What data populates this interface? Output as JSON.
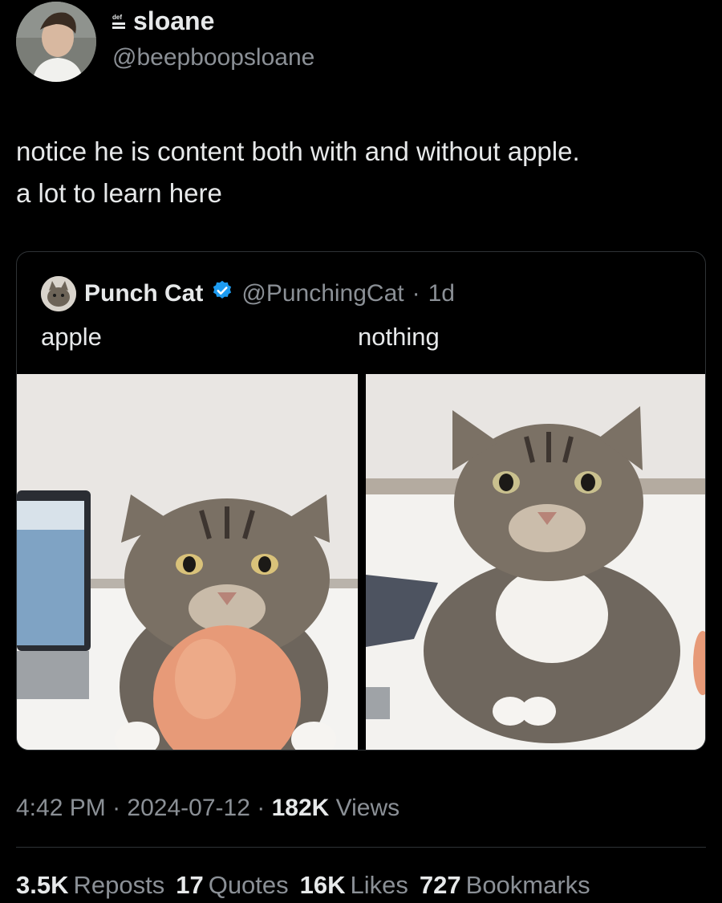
{
  "post": {
    "author_name": "sloane",
    "author_handle": "@beepboopsloane",
    "author_badge_icon": "def-icon",
    "text_line1": "notice he is content both with and without apple.",
    "text_line2": "a lot to learn here"
  },
  "quote": {
    "author_name": "Punch Cat",
    "verified_icon": "verified-badge-icon",
    "handle": "@PunchingCat",
    "separator": "·",
    "age": "1d",
    "label_left": "apple",
    "label_right": "nothing"
  },
  "meta": {
    "time": "4:42 PM",
    "sep1": "·",
    "date": "2024-07-12",
    "sep2": "·",
    "views_count": "182K",
    "views_label": "Views"
  },
  "stats": [
    {
      "count": "3.5K",
      "label": "Reposts"
    },
    {
      "count": "17",
      "label": "Quotes"
    },
    {
      "count": "16K",
      "label": "Likes"
    },
    {
      "count": "727",
      "label": "Bookmarks"
    }
  ],
  "colors": {
    "background": "#000000",
    "text_primary": "#e7e9ea",
    "text_secondary": "#8b9096",
    "verified_blue": "#1d9bf0",
    "border": "#2f3336"
  }
}
